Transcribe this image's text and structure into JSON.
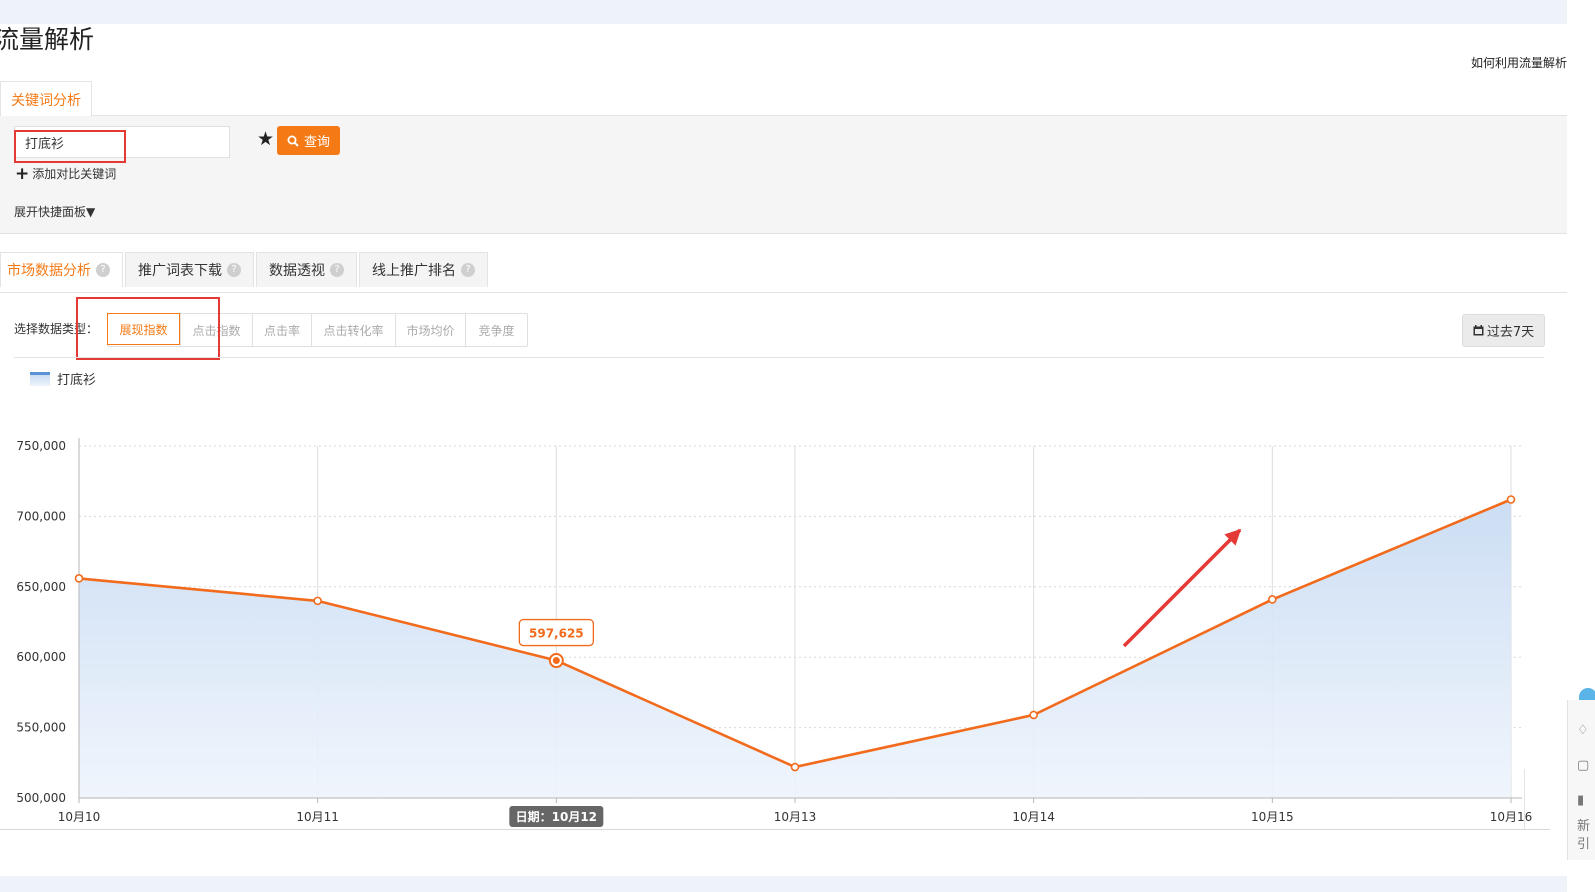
{
  "page": {
    "title": "流量解析",
    "help_link": "如何利用流量解析"
  },
  "top_tabs": [
    {
      "label": "关键词分析",
      "active": true
    }
  ],
  "search": {
    "keyword_value": "打底衫",
    "query_button": "查询",
    "add_compare": "添加对比关键词",
    "expand_panel": "展开快捷面板"
  },
  "analysis_tabs": [
    {
      "label": "市场数据分析",
      "active": true
    },
    {
      "label": "推广词表下载",
      "active": false
    },
    {
      "label": "数据透视",
      "active": false
    },
    {
      "label": "线上推广排名",
      "active": false
    }
  ],
  "data_type": {
    "label": "选择数据类型：",
    "options": [
      {
        "label": "展现指数",
        "active": true
      },
      {
        "label": "点击指数",
        "active": false
      },
      {
        "label": "点击率",
        "active": false
      },
      {
        "label": "点击转化率",
        "active": false
      },
      {
        "label": "市场均价",
        "active": false
      },
      {
        "label": "竞争度",
        "active": false
      }
    ],
    "range_button": "过去7天"
  },
  "right_strip": {
    "glyph_1": "新",
    "glyph_2": "引"
  },
  "colors": {
    "accent": "#f57a16",
    "line": "#f26b1d",
    "area": "#c9dcf3",
    "highlight": "#e53935"
  },
  "chart_data": {
    "type": "area",
    "legend": [
      "打底衫"
    ],
    "x": [
      "10月10",
      "10月11",
      "10月12",
      "10月13",
      "10月14",
      "10月15",
      "10月16"
    ],
    "series": [
      {
        "name": "打底衫",
        "values": [
          656000,
          640000,
          597625,
          522000,
          559000,
          641000,
          712000
        ]
      }
    ],
    "ylim": [
      500000,
      750000
    ],
    "yticks": [
      "500,000",
      "550,000",
      "600,000",
      "650,000",
      "700,000",
      "750,000"
    ],
    "tooltip": {
      "index": 2,
      "value_label": "597,625",
      "date_label": "日期：10月12"
    },
    "grid": true
  }
}
